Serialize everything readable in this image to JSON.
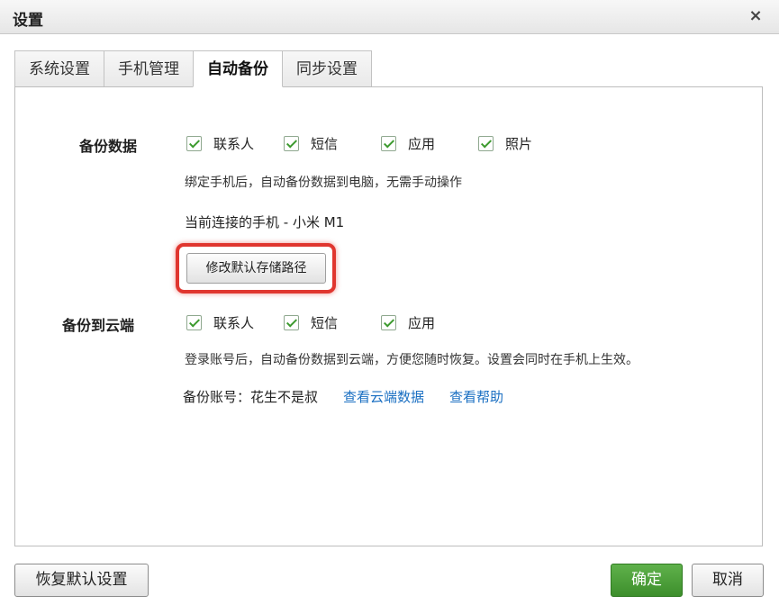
{
  "window": {
    "title": "设置",
    "close": "×"
  },
  "tabs": [
    {
      "label": "系统设置"
    },
    {
      "label": "手机管理"
    },
    {
      "label": "自动备份"
    },
    {
      "label": "同步设置"
    }
  ],
  "backup_data": {
    "label": "备份数据",
    "options": [
      {
        "label": "联系人",
        "checked": true
      },
      {
        "label": "短信",
        "checked": true
      },
      {
        "label": "应用",
        "checked": true
      },
      {
        "label": "照片",
        "checked": true
      }
    ],
    "description": "绑定手机后，自动备份数据到电脑，无需手动操作",
    "connected_phone": "当前连接的手机 - 小米 M1",
    "change_path_button": "修改默认存储路径"
  },
  "backup_cloud": {
    "label": "备份到云端",
    "options": [
      {
        "label": "联系人",
        "checked": true
      },
      {
        "label": "短信",
        "checked": true
      },
      {
        "label": "应用",
        "checked": true
      }
    ],
    "description": "登录账号后，自动备份数据到云端，方便您随时恢复。设置会同时在手机上生效。",
    "account": "备份账号：花生不是叔",
    "view_cloud_link": "查看云端数据",
    "help_link": "查看帮助"
  },
  "footer": {
    "restore_default": "恢复默认设置",
    "ok": "确定",
    "cancel": "取消"
  },
  "colors": {
    "accent_green": "#3d8f2c",
    "link_blue": "#1a6fc2",
    "highlight_red": "#e0362f"
  }
}
